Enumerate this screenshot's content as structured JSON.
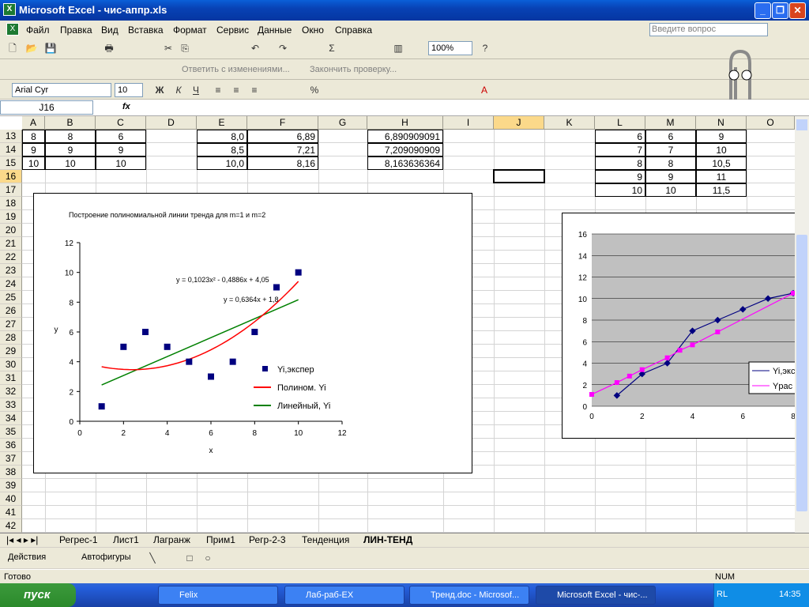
{
  "window": {
    "title": "Microsoft Excel - чис-аппр.xls"
  },
  "menu": {
    "items": [
      "Файл",
      "Правка",
      "Вид",
      "Вставка",
      "Формат",
      "Сервис",
      "Данные",
      "Окно",
      "Справка"
    ],
    "ask_placeholder": "Введите вопрос"
  },
  "toolbar": {
    "zoom": "100%",
    "reply_changes": "Ответить с изменениями...",
    "end_review": "Закончить проверку...",
    "font": "Arial Cyr",
    "font_size": "10"
  },
  "formula_bar": {
    "name_box": "J16",
    "fx": "fx",
    "value": ""
  },
  "columns": [
    "A",
    "B",
    "C",
    "D",
    "E",
    "F",
    "G",
    "H",
    "I",
    "J",
    "K",
    "L",
    "M",
    "N",
    "O"
  ],
  "rows": [
    "13",
    "14",
    "15",
    "16",
    "17",
    "18",
    "19",
    "20",
    "21",
    "22",
    "23",
    "24",
    "25",
    "26",
    "27",
    "28",
    "29",
    "30",
    "31",
    "32",
    "33",
    "34",
    "35",
    "36",
    "37",
    "38",
    "39",
    "40",
    "41",
    "42"
  ],
  "cells": {
    "A13": "8",
    "B13": "8",
    "C13": "6",
    "E13": "8,0",
    "F13": "6,89",
    "H13": "6,890909091",
    "L13": "6",
    "M13": "6",
    "N13": "9",
    "A14": "9",
    "B14": "9",
    "C14": "9",
    "E14": "8,5",
    "F14": "7,21",
    "H14": "7,209090909",
    "L14": "7",
    "M14": "7",
    "N14": "10",
    "A15": "10",
    "B15": "10",
    "C15": "10",
    "E15": "10,0",
    "F15": "8,16",
    "H15": "8,163636364",
    "L15": "8",
    "M15": "8",
    "N15": "10,5",
    "L16": "9",
    "M16": "9",
    "N16": "11",
    "L17": "10",
    "M17": "10",
    "N17": "11,5"
  },
  "chart_data": [
    {
      "type": "scatter",
      "title": "Построение полиномиальной линии тренда для  m=1 и  m=2",
      "xlabel": "x",
      "ylabel": "y",
      "xlim": [
        0,
        12
      ],
      "ylim": [
        0,
        12
      ],
      "xticks": [
        "0",
        "2",
        "4",
        "6",
        "8",
        "10",
        "12"
      ],
      "yticks": [
        "0",
        "2",
        "4",
        "6",
        "8",
        "10",
        "12"
      ],
      "series": [
        {
          "name": "Yi,экспер",
          "color": "#000080",
          "x": [
            1,
            2,
            3,
            4,
            5,
            6,
            7,
            8,
            9,
            10
          ],
          "y": [
            1,
            5,
            6,
            5,
            4,
            3,
            4,
            6,
            9,
            10
          ]
        },
        {
          "name": "Полином. Yi",
          "color": "#ff0000"
        },
        {
          "name": "Линейный, Yi",
          "color": "#008000"
        }
      ],
      "annotations": [
        "y = 0,1023x² - 0,4886x + 4,05",
        "y = 0,6364x + 1,8"
      ]
    },
    {
      "type": "line",
      "xlim": [
        0,
        8
      ],
      "ylim": [
        0,
        16
      ],
      "xticks": [
        "0",
        "2",
        "4",
        "6",
        "8"
      ],
      "yticks": [
        "0",
        "2",
        "4",
        "6",
        "8",
        "10",
        "12",
        "14",
        "16"
      ],
      "series": [
        {
          "name": "Yi,экс",
          "color": "#000080",
          "x": [
            1,
            2,
            3,
            4,
            5,
            6,
            7,
            8
          ],
          "y": [
            1,
            3,
            4,
            7,
            8,
            9,
            10,
            10.5
          ]
        },
        {
          "name": "Yрас",
          "color": "#ff00ff",
          "x": [
            0,
            1,
            1.5,
            2,
            3,
            3.5,
            4,
            5,
            8
          ],
          "y": [
            1.1,
            2.2,
            2.8,
            3.4,
            4.5,
            5.2,
            5.7,
            6.9,
            10.5
          ]
        }
      ]
    }
  ],
  "sheet_tabs": [
    "Регрес-1",
    "Лист1",
    "Лагранж",
    "Прим1",
    "Регр-2-3",
    "Тенденция",
    "ЛИН-ТЕНД"
  ],
  "drawing": {
    "actions": "Действия",
    "autoshapes": "Автофигуры"
  },
  "status": {
    "left": "Готово",
    "num": "NUM"
  },
  "taskbar": {
    "start": "пуск",
    "tasks": [
      "Felix",
      "Лаб-раб-EX",
      "Тренд.doc - Microsof...",
      "Microsoft Excel - чис-..."
    ],
    "lang": "RL",
    "time": "14:35"
  }
}
